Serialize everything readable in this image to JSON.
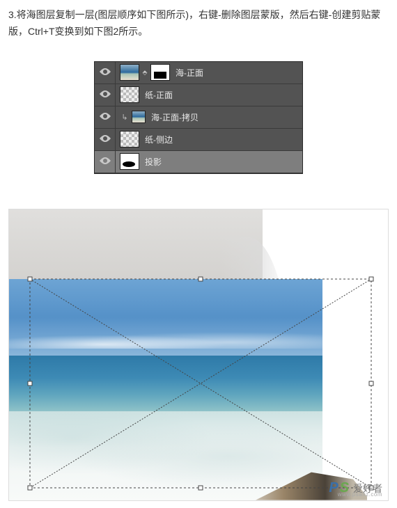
{
  "instruction": "3.将海图层复制一层(图层顺序如下图所示)，右键-删除图层蒙版，然后右键-创建剪贴蒙版，Ctrl+T变换到如下图2所示。",
  "layers": [
    {
      "name": "海-正面"
    },
    {
      "name": "纸-正面"
    },
    {
      "name": "海-正面-拷贝"
    },
    {
      "name": "纸-侧边"
    },
    {
      "name": "投影"
    }
  ],
  "watermark": {
    "brand_p": "P",
    "brand_s": "S",
    "brand_cn": "爱好者",
    "url": "www.psahz.com"
  }
}
